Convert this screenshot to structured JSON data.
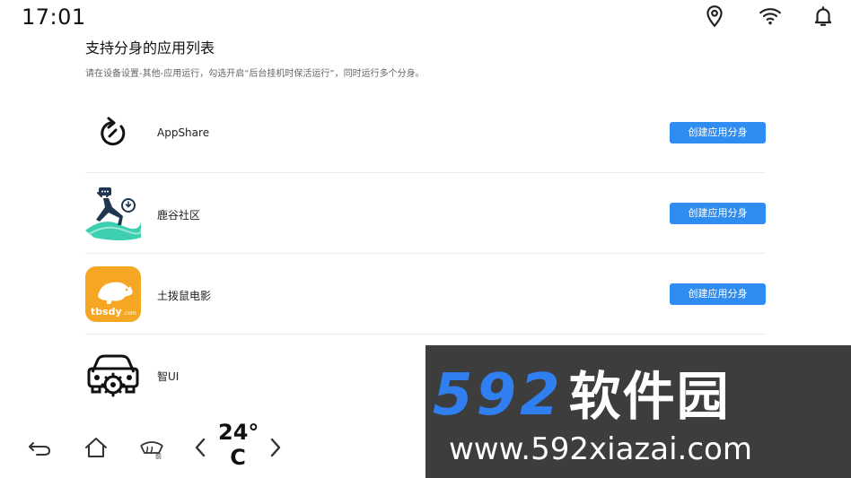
{
  "status": {
    "time": "17:01",
    "icons": [
      "location-icon",
      "wifi-icon",
      "bell-icon"
    ]
  },
  "page": {
    "title": "支持分身的应用列表",
    "subtitle": "请在设备设置-其他-应用运行，勾选开启“后台挂机时保活运行”，同时运行多个分身。"
  },
  "apps": [
    {
      "name": "AppShare",
      "icon": "appshare-icon",
      "button": "创建应用分身"
    },
    {
      "name": "鹿谷社区",
      "icon": "lugu-icon",
      "button": "创建应用分身"
    },
    {
      "name": "土拨鼠电影",
      "icon": "tbsdy-icon",
      "icon_text": "tbsdy",
      "icon_subtext": ".com",
      "button": "创建应用分身"
    },
    {
      "name": "智UI",
      "icon": "zhiui-icon"
    }
  ],
  "navbar": {
    "icons": [
      "back-icon",
      "home-icon",
      "defrost-icon",
      "chevron-left-icon",
      "chevron-right-icon"
    ],
    "defrost_label": "前",
    "temperature": "24°",
    "temperature_unit": "C"
  },
  "watermark": {
    "brand_number": "592",
    "brand_text": "软件园",
    "url": "www.592xiazai.com"
  },
  "colors": {
    "accent": "#2f8cf0",
    "tbsdy_orange": "#f5a623",
    "lugu_teal": "#3ccfb0",
    "watermark_bg": "#3d3d3d",
    "watermark_blue": "#2f7ff0"
  }
}
